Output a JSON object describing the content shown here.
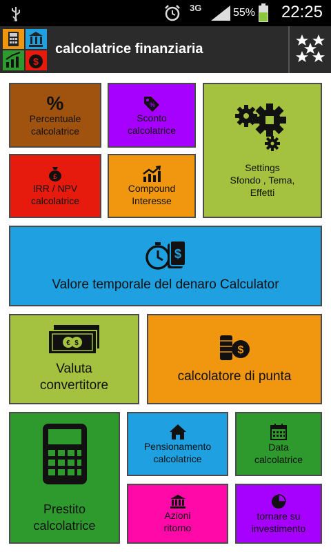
{
  "status": {
    "network": "3G",
    "battery": "55%",
    "time": "22:25"
  },
  "app": {
    "title": "calcolatrice finanziaria"
  },
  "tiles": {
    "percentuale": {
      "l1": "Percentuale",
      "l2": "calcolatrice",
      "color": "#a0520f"
    },
    "sconto": {
      "l1": "Sconto",
      "l2": "calcolatrice",
      "color": "#a600ff"
    },
    "settings": {
      "l1": "Settings",
      "l2": "Sfondo , Tema,",
      "l3": "Effetti",
      "color": "#a4c23f"
    },
    "irr": {
      "l1": "IRR / NPV",
      "l2": "calcolatrice",
      "color": "#e61b0e"
    },
    "compound": {
      "l1": "Compound",
      "l2": "Interesse",
      "color": "#f0960f"
    },
    "tvm": {
      "l1": "Valore temporale del denaro Calculator",
      "color": "#1ea0e1"
    },
    "valuta": {
      "l1": "Valuta",
      "l2": "convertitore",
      "color": "#a4c23f"
    },
    "punta": {
      "l1": "calcolatore di punta",
      "color": "#f0960f"
    },
    "prestito": {
      "l1": "Prestito",
      "l2": "calcolatrice",
      "color": "#2e9a2e"
    },
    "pensionamento": {
      "l1": "Pensionamento",
      "l2": "calcolatrice",
      "color": "#1ea0e1"
    },
    "data": {
      "l1": "Data",
      "l2": "calcolatrice",
      "color": "#2e9a2e"
    },
    "azioni": {
      "l1": "Azioni",
      "l2": "ritorno",
      "color": "#ff0aa8"
    },
    "investimento": {
      "l1": "tornare su",
      "l2": "investimento",
      "color": "#a600ff"
    }
  }
}
